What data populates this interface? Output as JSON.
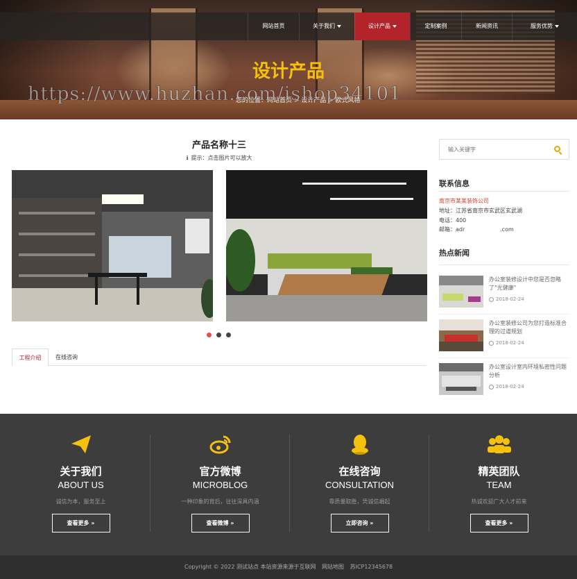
{
  "nav": {
    "items": [
      "网站首页",
      "关于我们",
      "设计产品",
      "定制案例",
      "新闻资讯",
      "服务优势"
    ],
    "active": "设计产品"
  },
  "banner": {
    "title": "设计产品",
    "watermark": "https://www.huzhan.com/ishop34101",
    "breadcrumb": "您的位置：网站首页 > 设计产品 > 欧式风格"
  },
  "product": {
    "title": "产品名称十三",
    "tip": "提示：点击图片可以放大",
    "tab_intro": "工程介绍",
    "tab_consult": "在线咨询"
  },
  "sidebar": {
    "search_placeholder": "输入关键字",
    "contact_heading": "联系信息",
    "contact": {
      "company": "南京市某某装饰公司",
      "address": "地址：江苏省南京市玄武区玄武湖",
      "phone": "电话：400",
      "email": "邮箱：adr                    .com"
    },
    "news_heading": "热点新闻",
    "news": [
      {
        "title": "办公室装修设计中您是否忽略了\"光健康\"",
        "date": "2018-02-24"
      },
      {
        "title": "办公室装修公司为您打造标准合理的过道规划",
        "date": "2018-02-24"
      },
      {
        "title": "办公室设计室内环境私密性问题分析",
        "date": "2018-02-24"
      }
    ]
  },
  "footer": {
    "columns": [
      {
        "icon": "paper-plane-icon",
        "cn": "关于我们",
        "en": "ABOUT US",
        "desc": "诚信为本，服务至上",
        "button": "查看更多"
      },
      {
        "icon": "weibo-icon",
        "cn": "官方微博",
        "en": "MICROBLOG",
        "desc": "一种印象的背后，往往深具内涵",
        "button": "查看微博"
      },
      {
        "icon": "qq-icon",
        "cn": "在线咨询",
        "en": "CONSULTATION",
        "desc": "靠质量取胜，凭诚信崛起",
        "button": "立即咨询"
      },
      {
        "icon": "team-icon",
        "cn": "精英团队",
        "en": "TEAM",
        "desc": "热诚欢迎广大人才前来",
        "button": "查看更多"
      }
    ],
    "accent": "#f4c20d",
    "copyright": "Copyright © 2022 测试站点 本站资源来源于互联网",
    "sitemap": "网站地图",
    "icp": "苏ICP12345678"
  },
  "colors": {
    "brand_red": "#b3232a",
    "footer_bg": "#3e3d3d"
  }
}
